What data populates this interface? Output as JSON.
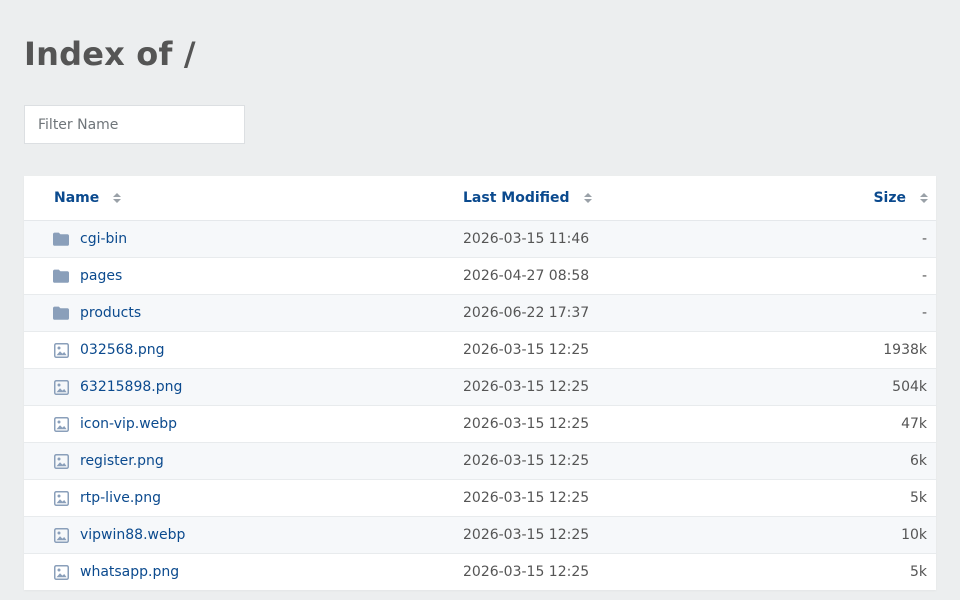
{
  "page": {
    "title": "Index of /"
  },
  "filter": {
    "placeholder": "Filter Name",
    "value": ""
  },
  "table": {
    "headers": {
      "name": "Name",
      "modified": "Last Modified",
      "size": "Size"
    },
    "rows": [
      {
        "type": "folder",
        "icon": "folder-icon",
        "name": "cgi-bin",
        "modified": "2026-03-15 11:46",
        "size": "-"
      },
      {
        "type": "folder",
        "icon": "folder-icon",
        "name": "pages",
        "modified": "2026-04-27 08:58",
        "size": "-"
      },
      {
        "type": "folder",
        "icon": "folder-icon",
        "name": "products",
        "modified": "2026-06-22 17:37",
        "size": "-"
      },
      {
        "type": "image",
        "icon": "image-file-icon",
        "name": "032568.png",
        "modified": "2026-03-15 12:25",
        "size": "1938k"
      },
      {
        "type": "image",
        "icon": "image-file-icon",
        "name": "63215898.png",
        "modified": "2026-03-15 12:25",
        "size": "504k"
      },
      {
        "type": "image",
        "icon": "image-file-icon",
        "name": "icon-vip.webp",
        "modified": "2026-03-15 12:25",
        "size": "47k"
      },
      {
        "type": "image",
        "icon": "image-file-icon",
        "name": "register.png",
        "modified": "2026-03-15 12:25",
        "size": "6k"
      },
      {
        "type": "image",
        "icon": "image-file-icon",
        "name": "rtp-live.png",
        "modified": "2026-03-15 12:25",
        "size": "5k"
      },
      {
        "type": "image",
        "icon": "image-file-icon",
        "name": "vipwin88.webp",
        "modified": "2026-03-15 12:25",
        "size": "10k"
      },
      {
        "type": "image",
        "icon": "image-file-icon",
        "name": "whatsapp.png",
        "modified": "2026-03-15 12:25",
        "size": "5k"
      }
    ]
  },
  "colors": {
    "background": "#eceeef",
    "link": "#0b4a8e",
    "icon": "#8a9fba",
    "title": "#555555"
  }
}
